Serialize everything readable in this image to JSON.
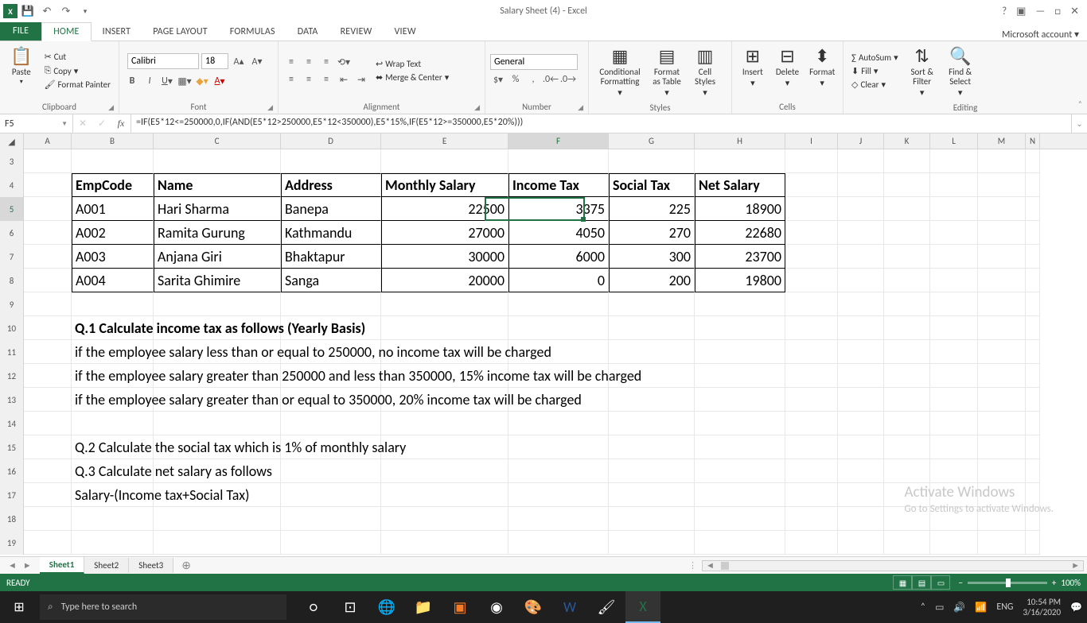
{
  "title": "Salary Sheet (4) - Excel",
  "account": "Microsoft account",
  "tabs": {
    "file": "FILE",
    "home": "HOME",
    "insert": "INSERT",
    "page": "PAGE LAYOUT",
    "formulas": "FORMULAS",
    "data": "DATA",
    "review": "REVIEW",
    "view": "VIEW"
  },
  "ribbon": {
    "clipboard": {
      "paste": "Paste",
      "cut": "Cut",
      "copy": "Copy",
      "painter": "Format Painter",
      "label": "Clipboard"
    },
    "font": {
      "name": "Calibri",
      "size": "18",
      "label": "Font"
    },
    "alignment": {
      "wrap": "Wrap Text",
      "merge": "Merge & Center",
      "label": "Alignment"
    },
    "number": {
      "format": "General",
      "label": "Number"
    },
    "styles": {
      "cond": "Conditional Formatting",
      "table": "Format as Table",
      "cell": "Cell Styles",
      "label": "Styles"
    },
    "cells": {
      "insert": "Insert",
      "delete": "Delete",
      "format": "Format",
      "label": "Cells"
    },
    "editing": {
      "autosum": "AutoSum",
      "fill": "Fill",
      "clear": "Clear",
      "sort": "Sort & Filter",
      "find": "Find & Select",
      "label": "Editing"
    }
  },
  "namebox": "F5",
  "formula": "=IF(E5*12<=250000,0,IF(AND(E5*12>250000,E5*12<350000),E5*15%,IF(E5*12>=350000,E5*20%)))",
  "cols": [
    "A",
    "B",
    "C",
    "D",
    "E",
    "F",
    "G",
    "H",
    "I",
    "J",
    "K",
    "L",
    "M",
    "N"
  ],
  "headers": [
    "EmpCode",
    "Name",
    "Address",
    "Monthly Salary",
    "Income Tax",
    "Social Tax",
    "Net Salary"
  ],
  "data": [
    [
      "A001",
      "Hari Sharma",
      "Banepa",
      "22500",
      "3375",
      "225",
      "18900"
    ],
    [
      "A002",
      "Ramita Gurung",
      "Kathmandu",
      "27000",
      "4050",
      "270",
      "22680"
    ],
    [
      "A003",
      "Anjana Giri",
      "Bhaktapur",
      "30000",
      "6000",
      "300",
      "23700"
    ],
    [
      "A004",
      "Sarita Ghimire",
      "Sanga",
      "20000",
      "0",
      "200",
      "19800"
    ]
  ],
  "text": {
    "q1": "Q.1 Calculate income tax as follows (Yearly Basis)",
    "l1": "if the employee salary less than or equal to 250000, no income tax will be charged",
    "l2": "if the employee salary greater than 250000 and less than 350000, 15% income tax will be charged",
    "l3": "if the employee salary greater than or equal to 350000, 20% income tax will be charged",
    "q2": "Q.2 Calculate the social tax which is 1% of monthly salary",
    "q3": "Q.3 Calculate net salary as follows",
    "l4": "Salary-(Income tax+Social Tax)"
  },
  "sheets": [
    "Sheet1",
    "Sheet2",
    "Sheet3"
  ],
  "status": "READY",
  "zoom": "100%",
  "watermark": {
    "t": "Activate Windows",
    "s": "Go to Settings to activate Windows."
  },
  "taskbar": {
    "search": "Type here to search",
    "lang": "ENG",
    "time": "10:54 PM",
    "date": "3/16/2020"
  }
}
